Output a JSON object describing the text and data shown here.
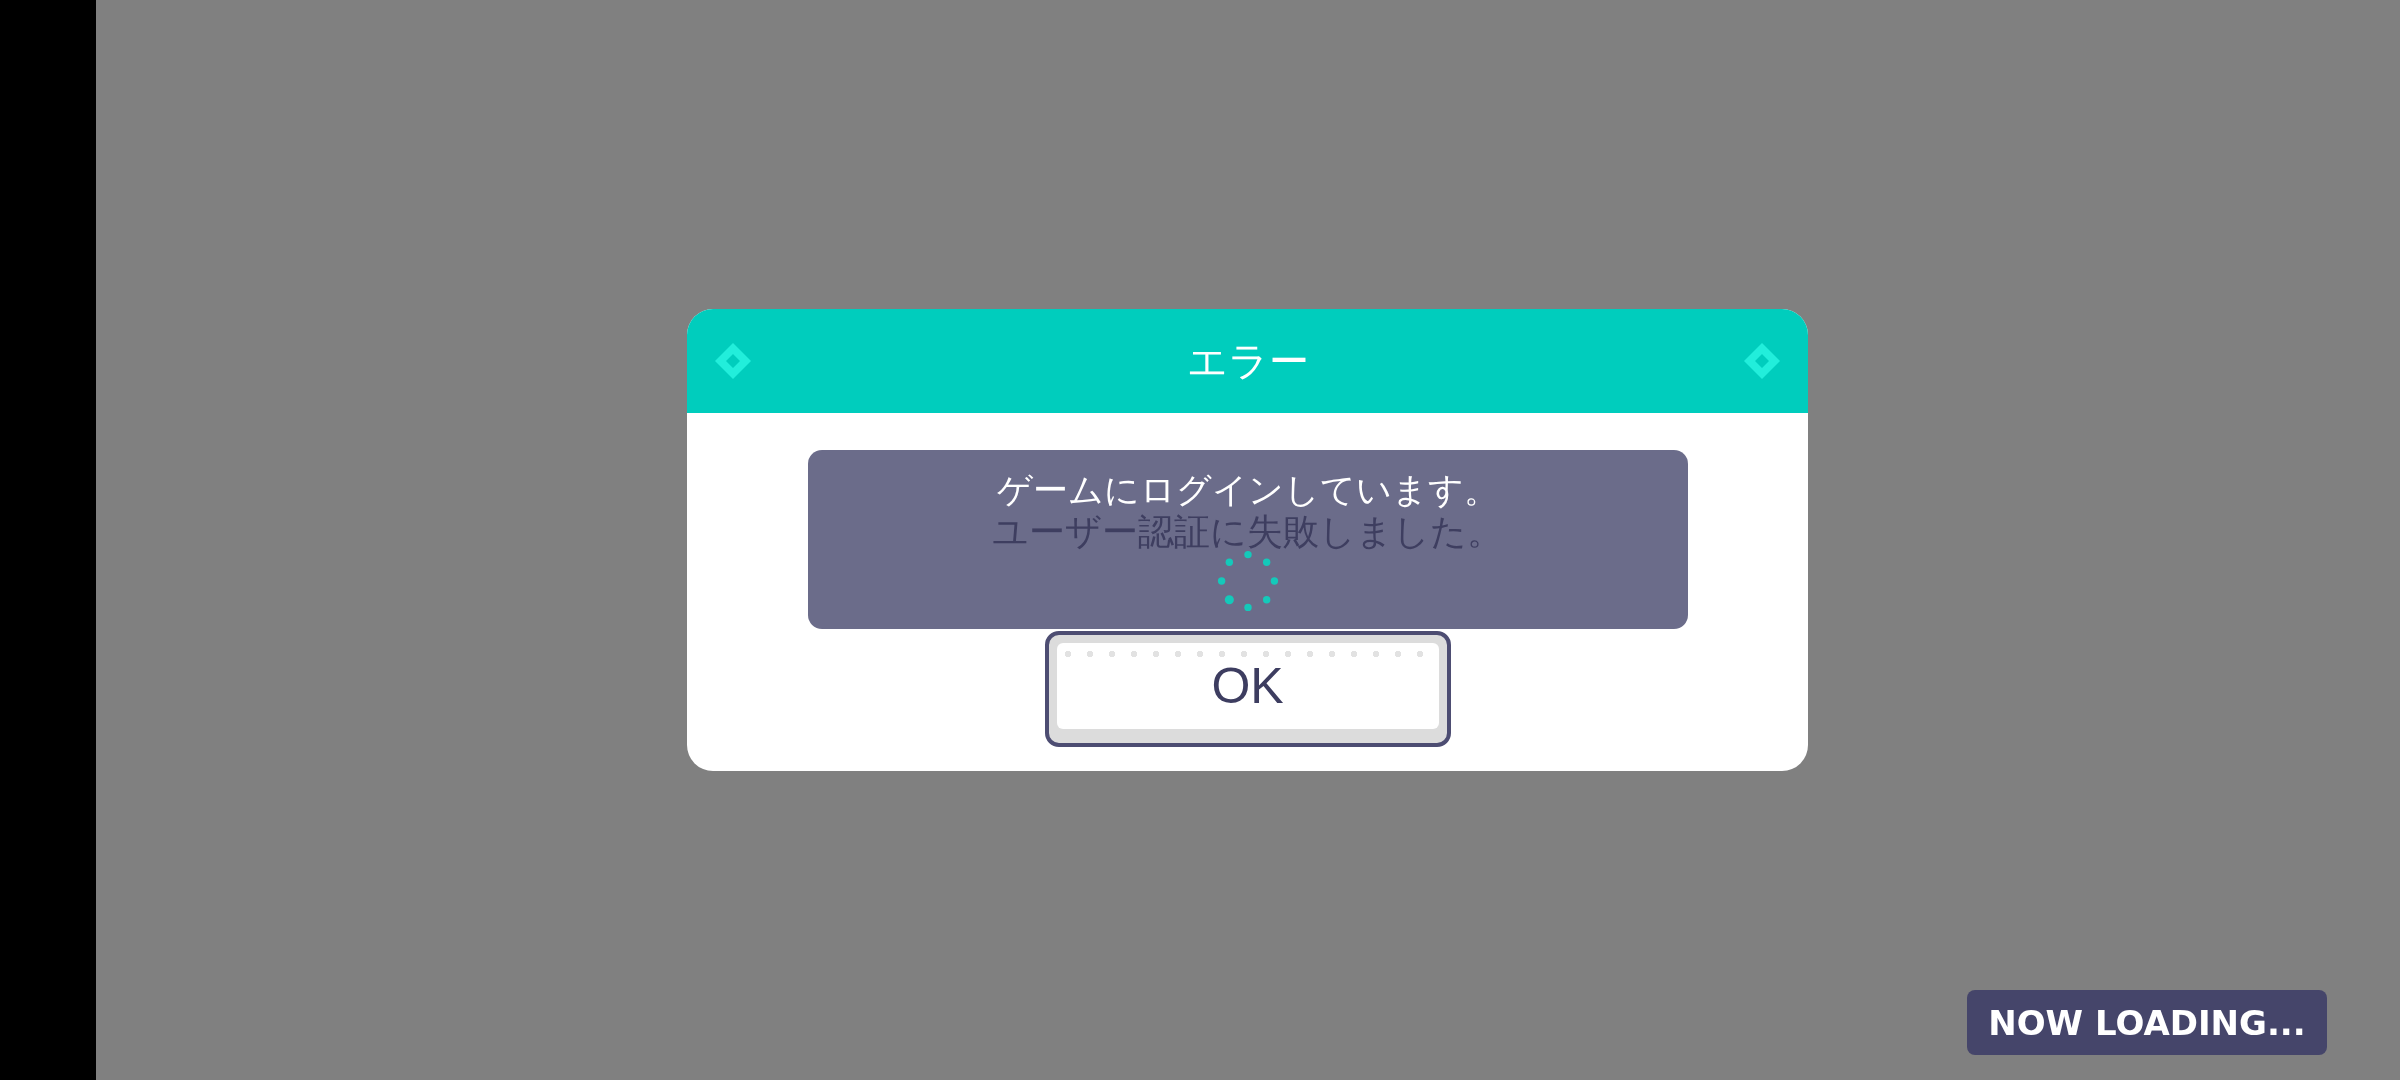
{
  "dialog": {
    "title": "エラー",
    "message": "ユーザー認証に失敗しました。",
    "button": "OK"
  },
  "loading_overlay": {
    "text": "ゲームにログインしています。"
  },
  "loading_badge": {
    "text": "NOW LOADING..."
  }
}
